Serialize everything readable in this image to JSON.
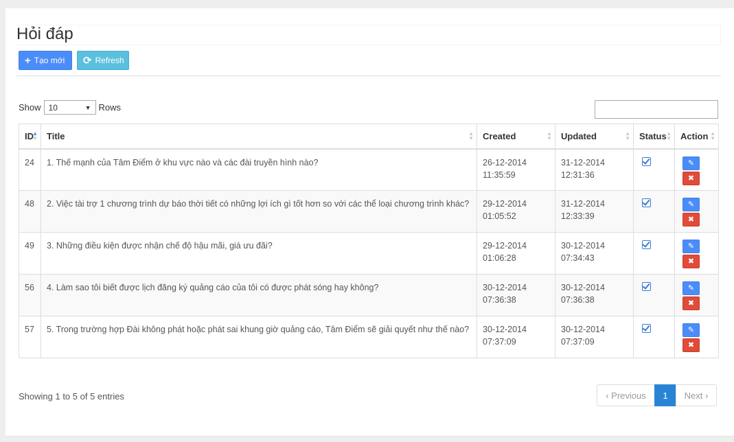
{
  "page": {
    "title": "Hỏi đáp"
  },
  "toolbar": {
    "new_icon": "+",
    "new_label": "Tạo mới",
    "refresh_icon": "⟳",
    "refresh_label": "Refresh"
  },
  "length": {
    "show": "Show",
    "value": "10",
    "rows": "Rows"
  },
  "table": {
    "columns": [
      "ID",
      "Title",
      "Created",
      "Updated",
      "Status",
      "Action"
    ],
    "rows": [
      {
        "id": "24",
        "title": "1. Thế mạnh của Tâm Điểm ở khu vực nào và các đài truyền hình nào?",
        "created_date": "26-12-2014",
        "created_time": "11:35:59",
        "updated_date": "31-12-2014",
        "updated_time": "12:31:36"
      },
      {
        "id": "48",
        "title": "2. Việc tài trợ 1 chương trình dự báo thời tiết có những lợi ích gì tốt hơn so với các thể loại chương trình khác?",
        "created_date": "29-12-2014",
        "created_time": "01:05:52",
        "updated_date": "31-12-2014",
        "updated_time": "12:33:39"
      },
      {
        "id": "49",
        "title": "3. Những điều kiện được nhận chế độ hậu mãi, giá ưu đãi?",
        "created_date": "29-12-2014",
        "created_time": "01:06:28",
        "updated_date": "30-12-2014",
        "updated_time": "07:34:43"
      },
      {
        "id": "56",
        "title": "4. Làm sao tôi biết được lịch đăng ký quảng cáo của tôi có được phát sóng hay không?",
        "created_date": "30-12-2014",
        "created_time": "07:36:38",
        "updated_date": "30-12-2014",
        "updated_time": "07:36:38"
      },
      {
        "id": "57",
        "title": "5. Trong trường hợp Đài không phát hoặc phát sai khung giờ quảng cáo, Tâm Điểm sẽ giải quyết như thế nào?",
        "created_date": "30-12-2014",
        "created_time": "07:37:09",
        "updated_date": "30-12-2014",
        "updated_time": "07:37:09"
      }
    ]
  },
  "footer": {
    "info": "Showing 1 to 5 of 5 entries",
    "prev": "‹ Previous",
    "current": "1",
    "next": "Next ›"
  },
  "colors": {
    "primary": "#4b8df8",
    "info": "#5bc0de",
    "danger": "#e04b3a",
    "active_page": "#2a84d6"
  }
}
